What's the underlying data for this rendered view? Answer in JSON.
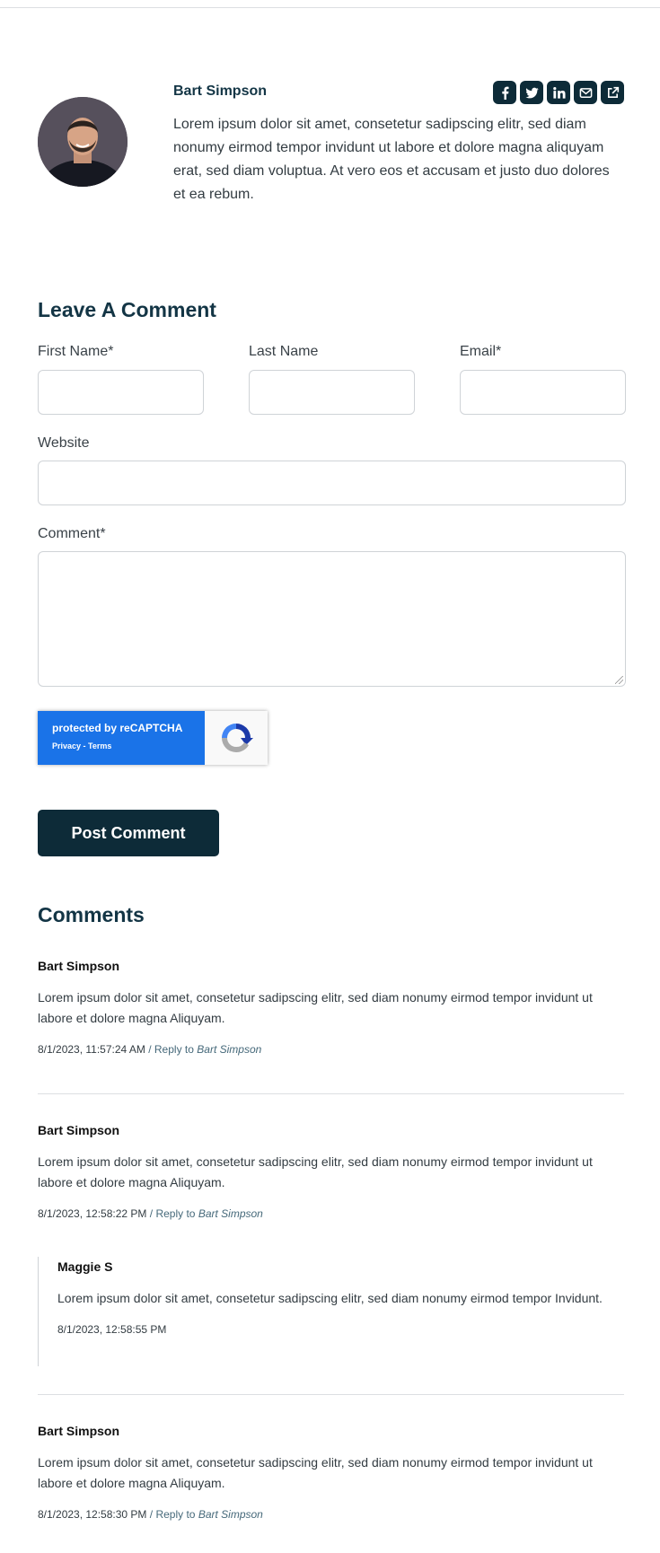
{
  "author": {
    "name": "Bart Simpson",
    "bio": "Lorem ipsum dolor sit amet, consetetur sadipscing elitr, sed diam nonumy eirmod tempor invidunt ut labore et dolore magna aliquyam erat, sed diam voluptua. At vero eos et accusam et justo duo dolores et ea rebum.",
    "socials": [
      "facebook-icon",
      "twitter-icon",
      "linkedin-icon",
      "email-icon",
      "external-link-icon"
    ]
  },
  "form": {
    "heading": "Leave A Comment",
    "first_name_label": "First Name*",
    "last_name_label": "Last Name",
    "email_label": "Email*",
    "website_label": "Website",
    "comment_label": "Comment*",
    "first_name_value": "",
    "last_name_value": "",
    "email_value": "",
    "website_value": "",
    "comment_value": "",
    "recaptcha_protected": "protected by reCAPTCHA",
    "recaptcha_links": "Privacy - Terms",
    "submit_label": "Post Comment"
  },
  "comments": {
    "heading": "Comments",
    "reply_prefix": "/ Reply to",
    "items": [
      {
        "name": "Bart Simpson",
        "text": "Lorem ipsum dolor sit amet, consetetur sadipscing elitr, sed diam nonumy eirmod tempor invidunt ut labore et dolore magna Aliquyam.",
        "timestamp": "8/1/2023, 11:57:24 AM",
        "reply_to": "Bart Simpson"
      },
      {
        "name": "Bart Simpson",
        "text": "Lorem ipsum dolor sit amet, consetetur sadipscing elitr, sed diam nonumy eirmod tempor invidunt ut labore et dolore magna Aliquyam.",
        "timestamp": "8/1/2023, 12:58:22 PM",
        "reply_to": "Bart Simpson",
        "replies": [
          {
            "name": "Maggie S",
            "text": "Lorem ipsum dolor sit amet, consetetur sadipscing elitr, sed diam nonumy eirmod tempor Invidunt.",
            "timestamp": "8/1/2023, 12:58:55 PM"
          }
        ]
      },
      {
        "name": "Bart Simpson",
        "text": "Lorem ipsum dolor sit amet, consetetur sadipscing elitr, sed diam nonumy eirmod tempor invidunt ut labore et dolore magna Aliquyam.",
        "timestamp": "8/1/2023, 12:58:30 PM",
        "reply_to": "Bart Simpson"
      }
    ]
  },
  "colors": {
    "brand_dark": "#0d2b38",
    "heading": "#133545",
    "recaptcha_blue": "#1a73e8",
    "link": "#46697a"
  }
}
